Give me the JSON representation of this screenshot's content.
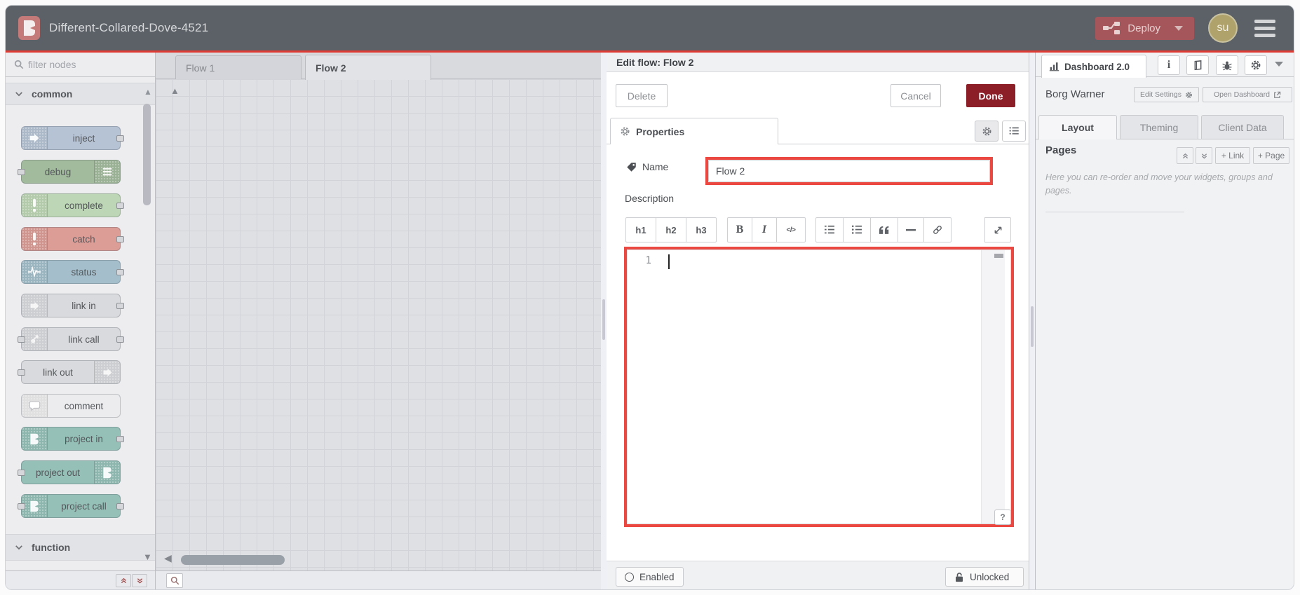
{
  "colors": {
    "header_bg": "#5b6167",
    "header_red_line": "#dd3b33",
    "logo_bg": "#c47a78",
    "deploy_bg": "#a5565b",
    "deploy_text": "#e8d2d2",
    "avatar_bg": "#b0a26b",
    "done_bg": "#8b1e26",
    "annotation_red": "#ea4840",
    "node_inject": "#b6c3d4",
    "node_debug": "#a3bb9d",
    "node_complete": "#bdd6b5",
    "node_catch": "#dc9d97",
    "node_status": "#a4bfcb",
    "node_link": "#d9dadd",
    "node_comment": "#ececee",
    "node_project": "#95c0b8"
  },
  "header": {
    "title": "Different-Collared-Dove-4521",
    "deploy_label": "Deploy",
    "avatar_initials": "su"
  },
  "palette": {
    "filter_placeholder": "filter nodes",
    "categories": [
      "common",
      "function"
    ],
    "nodes": [
      "inject",
      "debug",
      "complete",
      "catch",
      "status",
      "link in",
      "link call",
      "link out",
      "comment",
      "project in",
      "project out",
      "project call"
    ]
  },
  "workspace": {
    "tabs": [
      {
        "label": "Flow 1",
        "active": false
      },
      {
        "label": "Flow 2",
        "active": true
      }
    ]
  },
  "tray": {
    "title": "Edit flow: Flow 2",
    "buttons": {
      "delete": "Delete",
      "cancel": "Cancel",
      "done": "Done"
    },
    "properties_tab": "Properties",
    "name_label": "Name",
    "name_value": "Flow 2",
    "description_label": "Description",
    "md_toolbar": {
      "h1": "h1",
      "h2": "h2",
      "h3": "h3",
      "bold": "B",
      "italic": "I",
      "code": "</>"
    },
    "editor": {
      "line_number": "1"
    },
    "help_button": "?",
    "footer": {
      "enabled": "Enabled",
      "unlocked": "Unlocked"
    }
  },
  "sidebar": {
    "dashboard_tab": "Dashboard 2.0",
    "project_name": "Borg Warner",
    "edit_settings": "Edit Settings",
    "open_dashboard": "Open Dashboard",
    "tabs": [
      {
        "label": "Layout",
        "active": true
      },
      {
        "label": "Theming",
        "active": false
      },
      {
        "label": "Client Data",
        "active": false
      }
    ],
    "pages": {
      "title": "Pages",
      "add_link": "+ Link",
      "add_page": "+ Page",
      "help_text": "Here you can re-order and move your widgets, groups and pages."
    }
  }
}
